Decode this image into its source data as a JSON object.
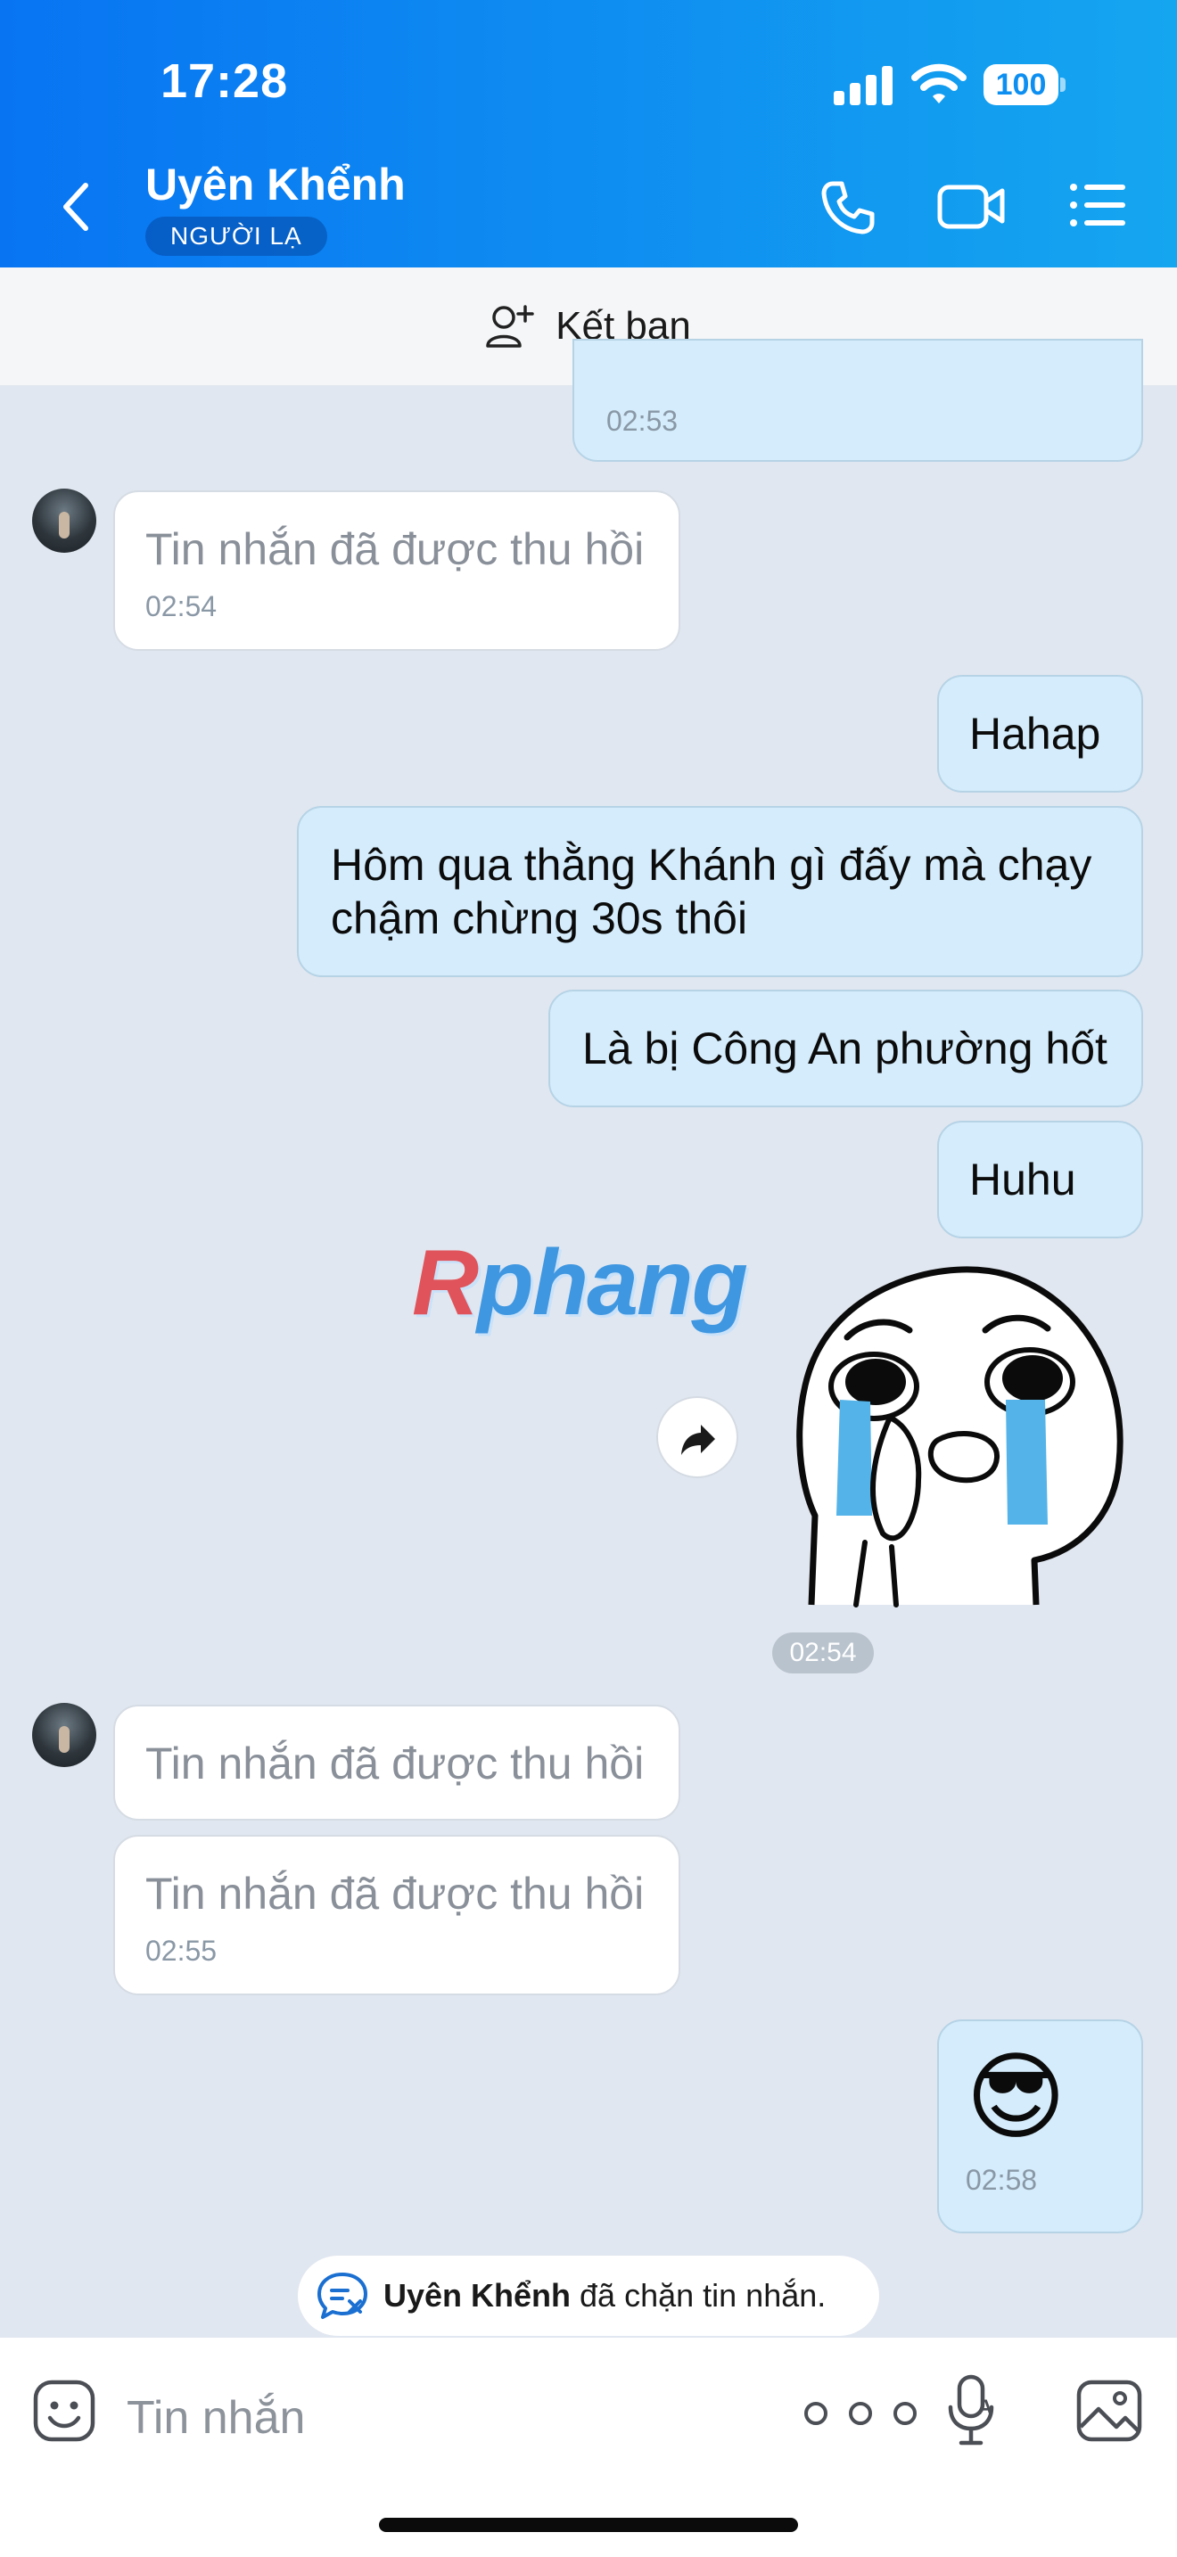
{
  "status_bar": {
    "time": "17:28",
    "battery": "100"
  },
  "header": {
    "contact_name": "Uyên Khểnh",
    "badge": "NGƯỜI LẠ"
  },
  "add_friend": {
    "label": "Kết bạn"
  },
  "messages": {
    "partial_time": "02:53",
    "recalled_1": {
      "text": "Tin nhắn đã được thu hồi",
      "time": "02:54"
    },
    "out_1": {
      "text": "Hahap"
    },
    "out_2": {
      "line1": "Hôm qua thằng Khánh gì đấy mà chạy",
      "line2": "chậm chừng 30s thôi"
    },
    "out_3": {
      "text": "Là bị Công An phường hốt"
    },
    "out_4": {
      "text": "Huhu"
    },
    "sticker_time": "02:54",
    "recalled_2": {
      "text": "Tin nhắn đã được thu hồi"
    },
    "recalled_3": {
      "text": "Tin nhắn đã được thu hồi",
      "time": "02:55"
    },
    "emoji_msg": {
      "emoji": "😎",
      "time": "02:58"
    }
  },
  "watermark": {
    "first": "R",
    "rest": "phang"
  },
  "blocked_notice": {
    "name": "Uyên Khểnh",
    "text": " đã chặn tin nhắn."
  },
  "input": {
    "placeholder": "Tin nhắn"
  },
  "colors": {
    "header_start": "#0874f2",
    "header_end": "#15a6f0",
    "outgoing_bubble": "#d4ecfb",
    "chat_background": "#e1e7f0"
  }
}
